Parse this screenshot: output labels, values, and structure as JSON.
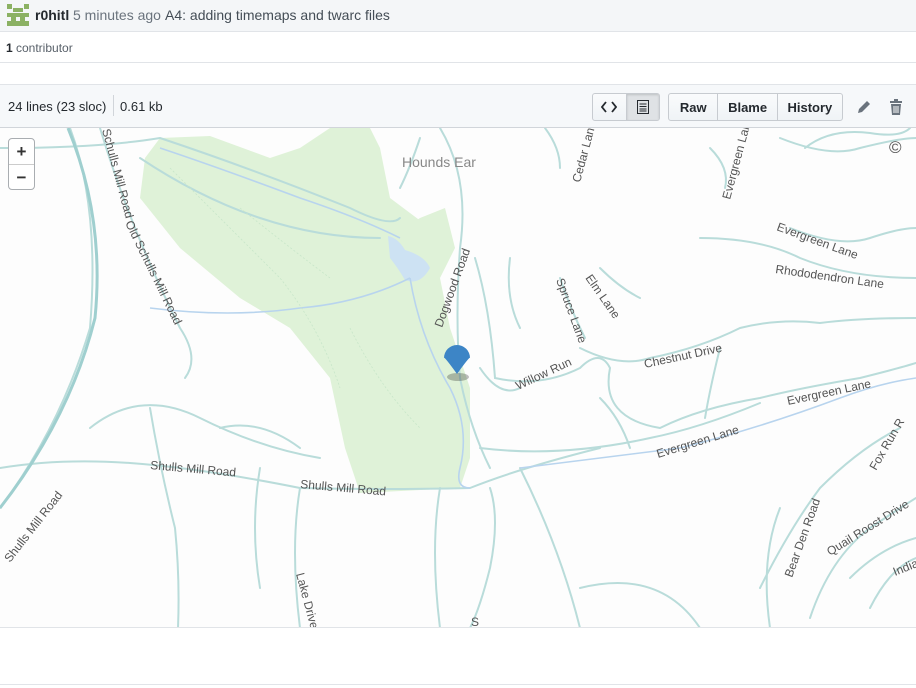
{
  "commit": {
    "author": "r0hitl",
    "time": "5 minutes ago",
    "message": "A4: adding timemaps and twarc files"
  },
  "contributors": {
    "count": "1",
    "label": "contributor"
  },
  "file": {
    "lines": "24 lines (23 sloc)",
    "size": "0.61 kb",
    "buttons": {
      "raw": "Raw",
      "blame": "Blame",
      "history": "History"
    }
  },
  "map": {
    "zoom_in": "+",
    "zoom_out": "−",
    "attribution": "©",
    "labels": {
      "hounds_ear": "Hounds Ear",
      "dogwood_road": "Dogwood Road",
      "spruce_lane": "Spruce Lane",
      "elm_lane": "Elm Lane",
      "chestnut_drive": "Chestnut Drive",
      "willow_run": "Willow Run",
      "evergreen_lane_1": "Evergreen Lane",
      "evergreen_lane_2": "Evergreen Lane",
      "evergreen_lane_3": "Evergreen Lane",
      "evergreen_lane_4": "Evergreen Lane",
      "rhododendron_lane": "Rhododendron Lane",
      "cedar_lane": "Cedar Lan",
      "shulls_mill_road_1": "Shulls Mill Road",
      "shulls_mill_road_2": "Shulls Mill Road",
      "shulls_mill_road_3": "Shulls Mill Road",
      "shulls_mill_road_top": "Schulls Mill Road",
      "old_shulls_mill_road": "Old Schulls Mill Road",
      "lake_drive": "Lake Drive",
      "fox_run": "Fox Run R",
      "bear_den_road": "Bear Den Road",
      "quail_roost_drive": "Quail Roost Drive",
      "india": "India",
      "s_road": "S"
    }
  }
}
